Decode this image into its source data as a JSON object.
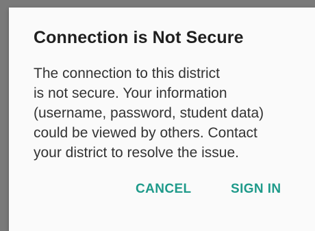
{
  "dialog": {
    "title": "Connection is Not Secure",
    "message_lines": [
      "The connection to this district",
      "is not secure. Your information",
      "(username, password, student data)",
      "could be viewed by others. Contact",
      "your district to resolve the issue."
    ],
    "buttons": {
      "cancel": "CANCEL",
      "sign_in": "SIGN IN"
    }
  },
  "colors": {
    "accent": "#1e9a8a",
    "dialog_background": "#fafafa",
    "scrim": "#7a7a7a",
    "title_text": "#1f1f1f",
    "body_text": "#333333"
  }
}
